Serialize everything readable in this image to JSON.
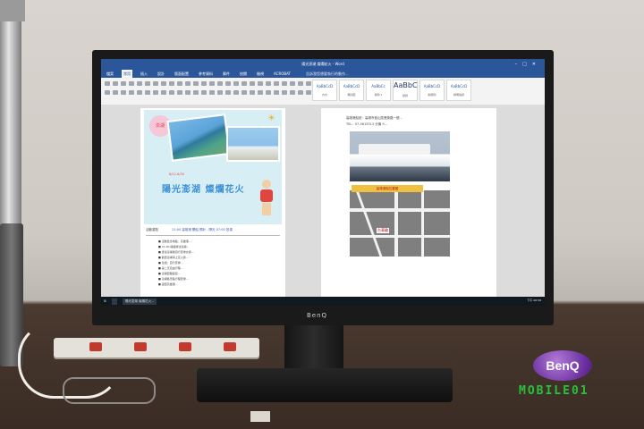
{
  "scene": {
    "description_free": true
  },
  "monitor": {
    "brand": "BenQ"
  },
  "word": {
    "window_title": "陽光澎湖 燦爛花火 - Word",
    "tabs": [
      "檔案",
      "常用",
      "插入",
      "設計",
      "版面配置",
      "參考資料",
      "郵件",
      "校閱",
      "檢視",
      "ACROBAT"
    ],
    "tell_me": "告訴我您想要執行的動作...",
    "styles": [
      {
        "sample": "AaBbCcD",
        "label": "內文"
      },
      {
        "sample": "AaBbCcD",
        "label": "無間距"
      },
      {
        "sample": "AaBbCc",
        "label": "標題 1"
      },
      {
        "sample": "AaBbC",
        "label": "標題"
      },
      {
        "sample": "AaBbCcD",
        "label": "副標題"
      },
      {
        "sample": "AaBbCcD",
        "label": "鮮明強調"
      }
    ],
    "page1": {
      "sticker": "澎湖",
      "poster_small": "6/12-6/30",
      "poster_title": "陽光澎湖  燦爛花火",
      "info_label": "活動重點",
      "info_value": "21:00 高雄港 開船 預計 - 隔天 07:00 抵達",
      "bullets": [
        "活動集合地點：高雄港…",
        "21:00 開船前往澎湖…",
        "抵達澎湖後自行安排交通…",
        "觀賞澎湖海上花火節…",
        "住宿：自行安排…",
        "第二天自由行程…",
        "澎湖回程船班…",
        "澎湖各景點行程安排…",
        "返回高雄港…"
      ]
    },
    "page2": {
      "line1": "高雄港船班：高雄市鼓山區蓬萊路一號…",
      "line2": "TEL：07-5615313 分機 9…",
      "map_caption": "高雄港船位置圖",
      "map_label": "台華輪"
    },
    "taskbar": {
      "items": [
        "",
        "陽光澎湖 燦爛花火..."
      ],
      "clock": "下午 06:58"
    }
  },
  "watermark": {
    "badge": "BenQ",
    "site": "MOBILE01"
  }
}
